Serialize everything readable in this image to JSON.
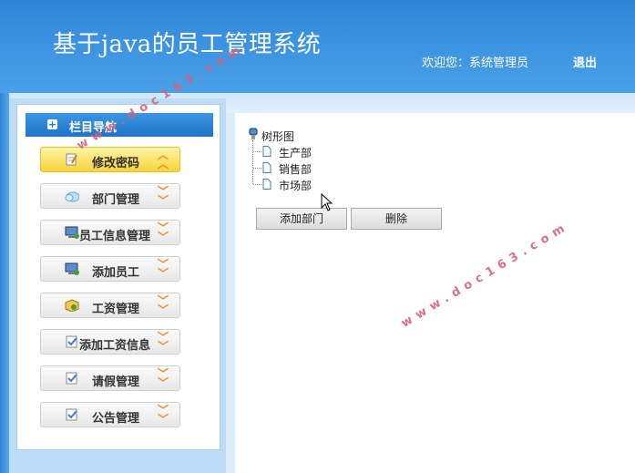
{
  "header": {
    "title": "基于java的员工管理系统",
    "welcome": "欢迎您：系统管理员",
    "logout": "退出"
  },
  "sidebar": {
    "title": "栏目导航",
    "items": [
      {
        "label": "修改密码",
        "icon": "edit-icon",
        "active": true
      },
      {
        "label": "部门管理",
        "icon": "cloud-icon"
      },
      {
        "label": "员工信息管理",
        "icon": "computer-icon"
      },
      {
        "label": "添加员工",
        "icon": "computer-add-icon"
      },
      {
        "label": "工资管理",
        "icon": "box-icon"
      },
      {
        "label": "添加工资信息",
        "icon": "edit-check-icon"
      },
      {
        "label": "请假管理",
        "icon": "edit-check-icon"
      },
      {
        "label": "公告管理",
        "icon": "edit-check-icon"
      }
    ]
  },
  "tree": {
    "root": "树形图",
    "nodes": [
      "生产部",
      "销售部",
      "市场部"
    ]
  },
  "actions": {
    "add": "添加部门",
    "delete": "删除"
  },
  "watermark": "www.doc163.com",
  "colors": {
    "header": "#3b92e0",
    "accent_active": "#f7d43a",
    "chevron": "#f08a1c"
  }
}
